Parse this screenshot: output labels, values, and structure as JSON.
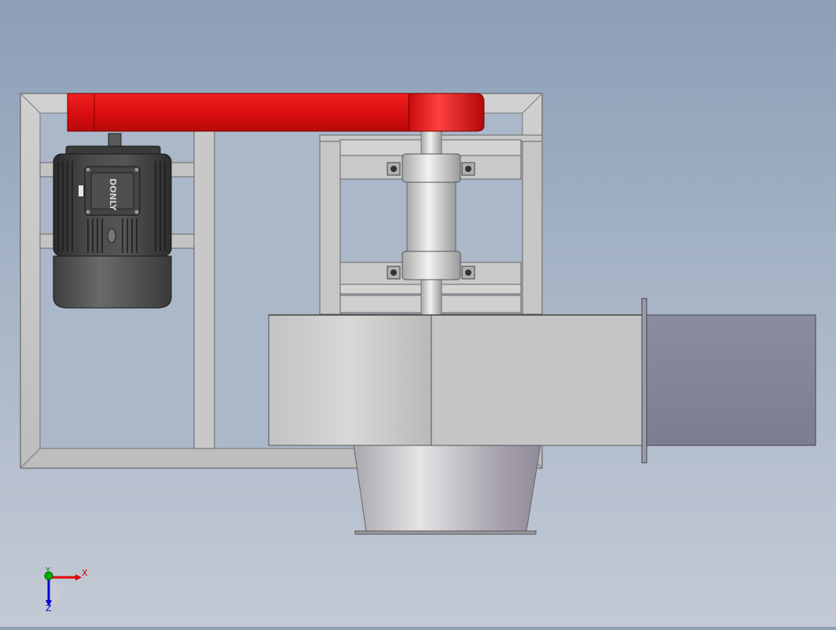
{
  "app": {
    "view_type": "cad-3d-model-viewport",
    "background_colors": [
      "#8c9fb6",
      "#c3cad5"
    ]
  },
  "model": {
    "frame_color": "#c8c8c8",
    "belt_guard_color": "#dd1111",
    "fan_housing_color": "#c4c4c4",
    "outlet_duct_color": "#828499",
    "motor_color": "#3c3c3c"
  },
  "motor": {
    "brand_label": "DONLY"
  },
  "triad": {
    "x_label": "X",
    "y_label": "Y",
    "z_label": "Z",
    "x_color": "#e00000",
    "y_color": "#00b000",
    "z_color": "#0000d0"
  }
}
